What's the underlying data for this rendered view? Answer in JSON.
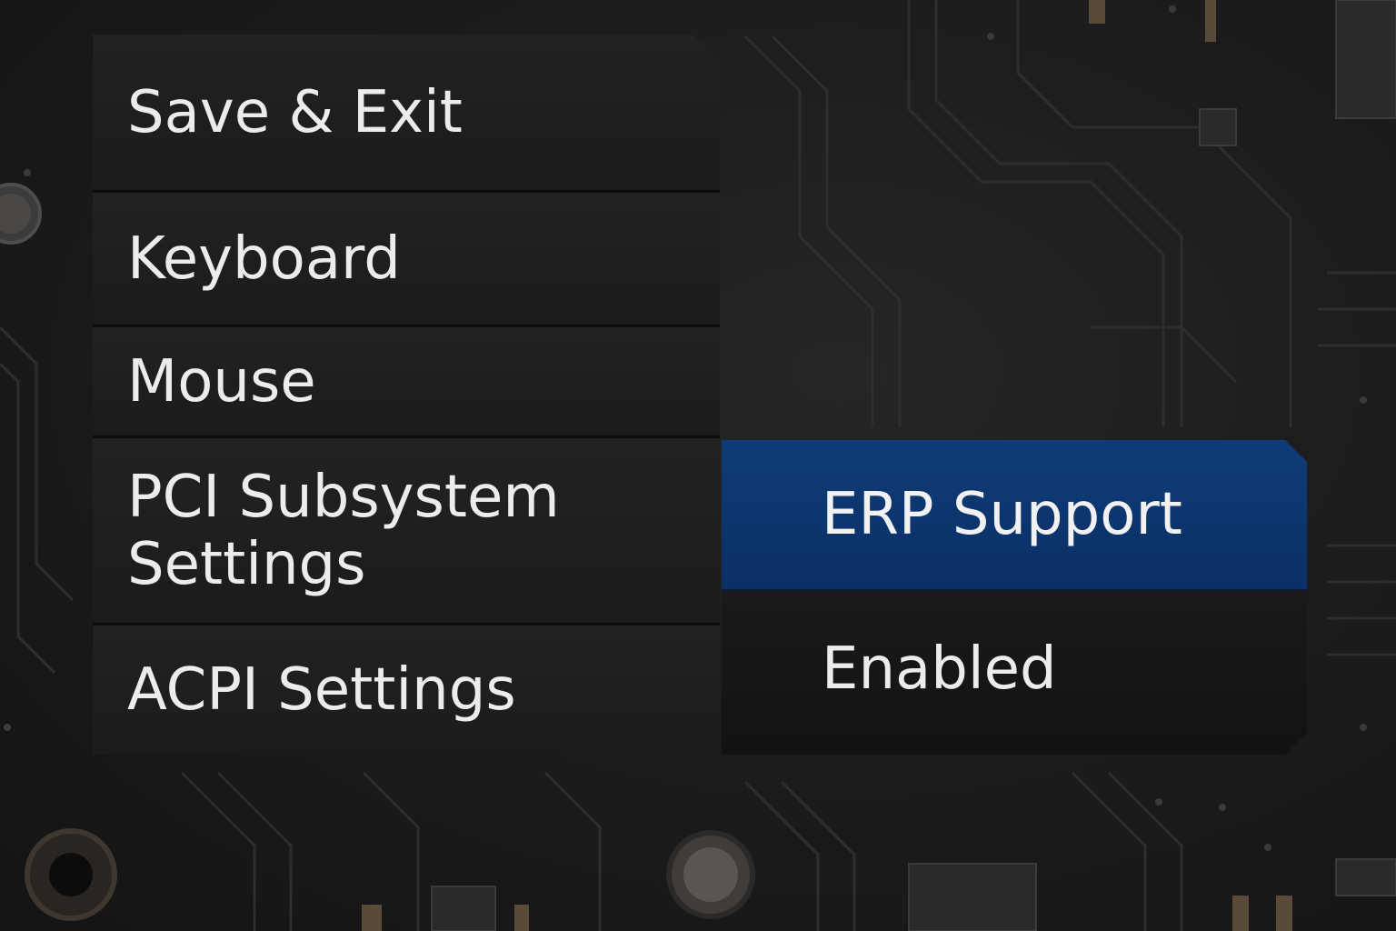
{
  "menu": {
    "items": [
      {
        "label": "Save & Exit"
      },
      {
        "label": "Keyboard"
      },
      {
        "label": "Mouse"
      },
      {
        "label_line1": "PCI Subsystem",
        "label_line2": "Settings"
      },
      {
        "label": "ACPI Settings"
      }
    ]
  },
  "submenu": {
    "header": "ERP Support",
    "value": "Enabled"
  },
  "colors": {
    "highlight": "#0f3c78",
    "panel": "#1d1d1d",
    "text": "#ececec"
  }
}
